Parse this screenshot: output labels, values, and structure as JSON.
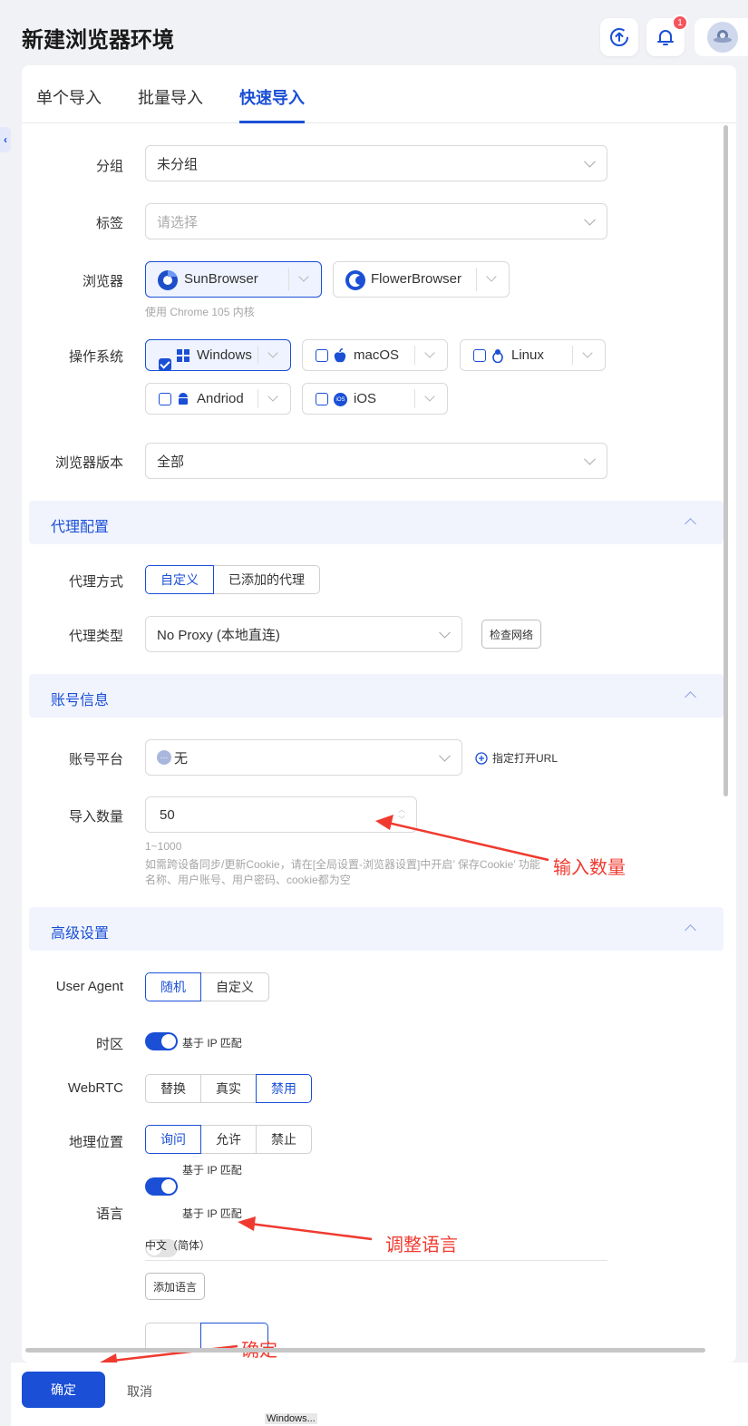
{
  "header": {
    "title": "新建浏览器环境",
    "notification_count": "1"
  },
  "tabs": [
    {
      "label": "单个导入"
    },
    {
      "label": "批量导入"
    },
    {
      "label": "快速导入"
    }
  ],
  "form": {
    "group": {
      "label": "分组",
      "value": "未分组"
    },
    "tags": {
      "label": "标签",
      "placeholder": "请选择"
    },
    "browser": {
      "label": "浏览器",
      "options": [
        "SunBrowser",
        "FlowerBrowser"
      ],
      "hint": "使用 Chrome 105 内核"
    },
    "os": {
      "label": "操作系统",
      "options": [
        "Windows",
        "macOS",
        "Linux",
        "Andriod",
        "iOS"
      ],
      "ios_badge": "iOS"
    },
    "browser_version": {
      "label": "浏览器版本",
      "value": "全部"
    }
  },
  "proxy_section": {
    "title": "代理配置",
    "method_label": "代理方式",
    "methods": [
      "自定义",
      "已添加的代理"
    ],
    "type_label": "代理类型",
    "type_value": "No Proxy (本地直连)",
    "check_network": "检查网络"
  },
  "account_section": {
    "title": "账号信息",
    "platform_label": "账号平台",
    "platform_value": "无",
    "open_url": "指定打开URL",
    "count_label": "导入数量",
    "count_value": "50",
    "count_range": "1~1000",
    "count_hint1": "如需跨设备同步/更新Cookie，请在[全局设置-浏览器设置]中开启’ 保存Cookie’ 功能",
    "count_hint2": "名称、用户账号、用户密码、cookie都为空"
  },
  "advanced_section": {
    "title": "高级设置",
    "ua_label": "User Agent",
    "ua_options": [
      "随机",
      "自定义"
    ],
    "timezone_label": "时区",
    "timezone_toggle": "基于 IP 匹配",
    "webrtc_label": "WebRTC",
    "webrtc_options": [
      "替换",
      "真实",
      "禁用"
    ],
    "geo_label": "地理位置",
    "geo_options": [
      "询问",
      "允许",
      "禁止"
    ],
    "geo_toggle": "基于 IP 匹配",
    "lang_label": "语言",
    "lang_toggle": "基于 IP 匹配",
    "lang_value": "中文（简体）",
    "add_language": "添加语言"
  },
  "annotations": {
    "count": "输入数量",
    "language": "调整语言",
    "confirm": "确定"
  },
  "footer": {
    "confirm": "确定",
    "cancel": "取消"
  },
  "taskbar": {
    "text": "Windows..."
  },
  "colors": {
    "accent": "#1a4fd6",
    "annotation": "#f03a2f",
    "section_bg": "#f1f4fd"
  }
}
